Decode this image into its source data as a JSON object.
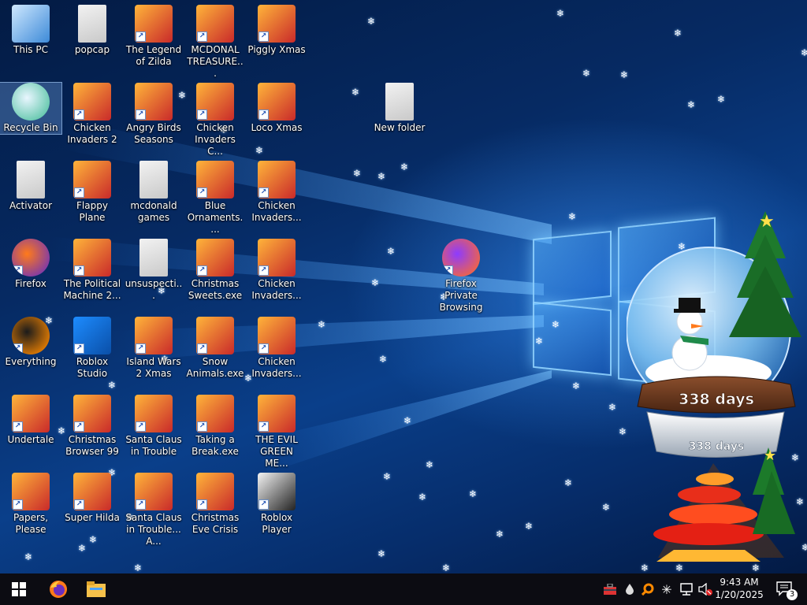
{
  "desktop_icons": [
    {
      "label": "This PC",
      "icon": "computer-icon"
    },
    {
      "label": "popcap",
      "icon": "folder-icon"
    },
    {
      "label": "The Legend of Zilda",
      "icon": "game-icon"
    },
    {
      "label": "MCDONAL TREASURE...",
      "icon": "game-icon"
    },
    {
      "label": "Piggly Xmas",
      "icon": "game-icon"
    },
    {
      "label": "Recycle Bin",
      "icon": "recycle-bin-icon"
    },
    {
      "label": "Chicken Invaders 2",
      "icon": "game-icon"
    },
    {
      "label": "Angry Birds Seasons",
      "icon": "game-icon"
    },
    {
      "label": "Chicken Invaders C...",
      "icon": "game-icon"
    },
    {
      "label": "Loco Xmas",
      "icon": "game-icon"
    },
    {
      "label": "New folder",
      "icon": "folder-icon"
    },
    {
      "label": "Activator",
      "icon": "folder-icon"
    },
    {
      "label": "Flappy Plane",
      "icon": "game-icon"
    },
    {
      "label": "mcdonald games",
      "icon": "folder-icon"
    },
    {
      "label": "Blue Ornaments....",
      "icon": "game-icon"
    },
    {
      "label": "Chicken Invaders...",
      "icon": "game-icon"
    },
    {
      "label": "Firefox",
      "icon": "firefox-icon"
    },
    {
      "label": "The Political Machine 2...",
      "icon": "game-icon"
    },
    {
      "label": "unsuspecti...",
      "icon": "folder-icon"
    },
    {
      "label": "Christmas Sweets.exe",
      "icon": "game-icon"
    },
    {
      "label": "Chicken Invaders...",
      "icon": "game-icon"
    },
    {
      "label": "Firefox Private Browsing",
      "icon": "firefox-private-icon"
    },
    {
      "label": "Everything",
      "icon": "search-icon"
    },
    {
      "label": "Roblox Studio",
      "icon": "roblox-studio-icon"
    },
    {
      "label": "Island Wars 2 Xmas",
      "icon": "game-icon"
    },
    {
      "label": "Snow Animals.exe",
      "icon": "game-icon"
    },
    {
      "label": "Chicken Invaders...",
      "icon": "game-icon"
    },
    {
      "label": "Undertale",
      "icon": "game-icon"
    },
    {
      "label": "Christmas Browser 99",
      "icon": "game-icon"
    },
    {
      "label": "Santa Claus in Trouble",
      "icon": "game-icon"
    },
    {
      "label": "Taking a Break.exe",
      "icon": "game-icon"
    },
    {
      "label": "THE EVIL GREEN ME...",
      "icon": "game-icon"
    },
    {
      "label": "Papers, Please",
      "icon": "game-icon"
    },
    {
      "label": "Super Hilda",
      "icon": "game-icon"
    },
    {
      "label": "Santa Claus in Trouble... A...",
      "icon": "game-icon"
    },
    {
      "label": "Christmas Eve Crisis",
      "icon": "game-icon"
    },
    {
      "label": "Roblox Player",
      "icon": "roblox-icon"
    }
  ],
  "widget": {
    "countdown_top": "338 days",
    "countdown_bottom": "338 days"
  },
  "taskbar": {
    "pinned": [
      "start-icon",
      "firefox-icon",
      "file-explorer-icon"
    ],
    "tray": {
      "time": "9:43 AM",
      "date": "1/20/2025",
      "notification_count": "3"
    }
  },
  "colors": {
    "accent": "#1c6fd6",
    "taskbar": "#0c0c12"
  }
}
